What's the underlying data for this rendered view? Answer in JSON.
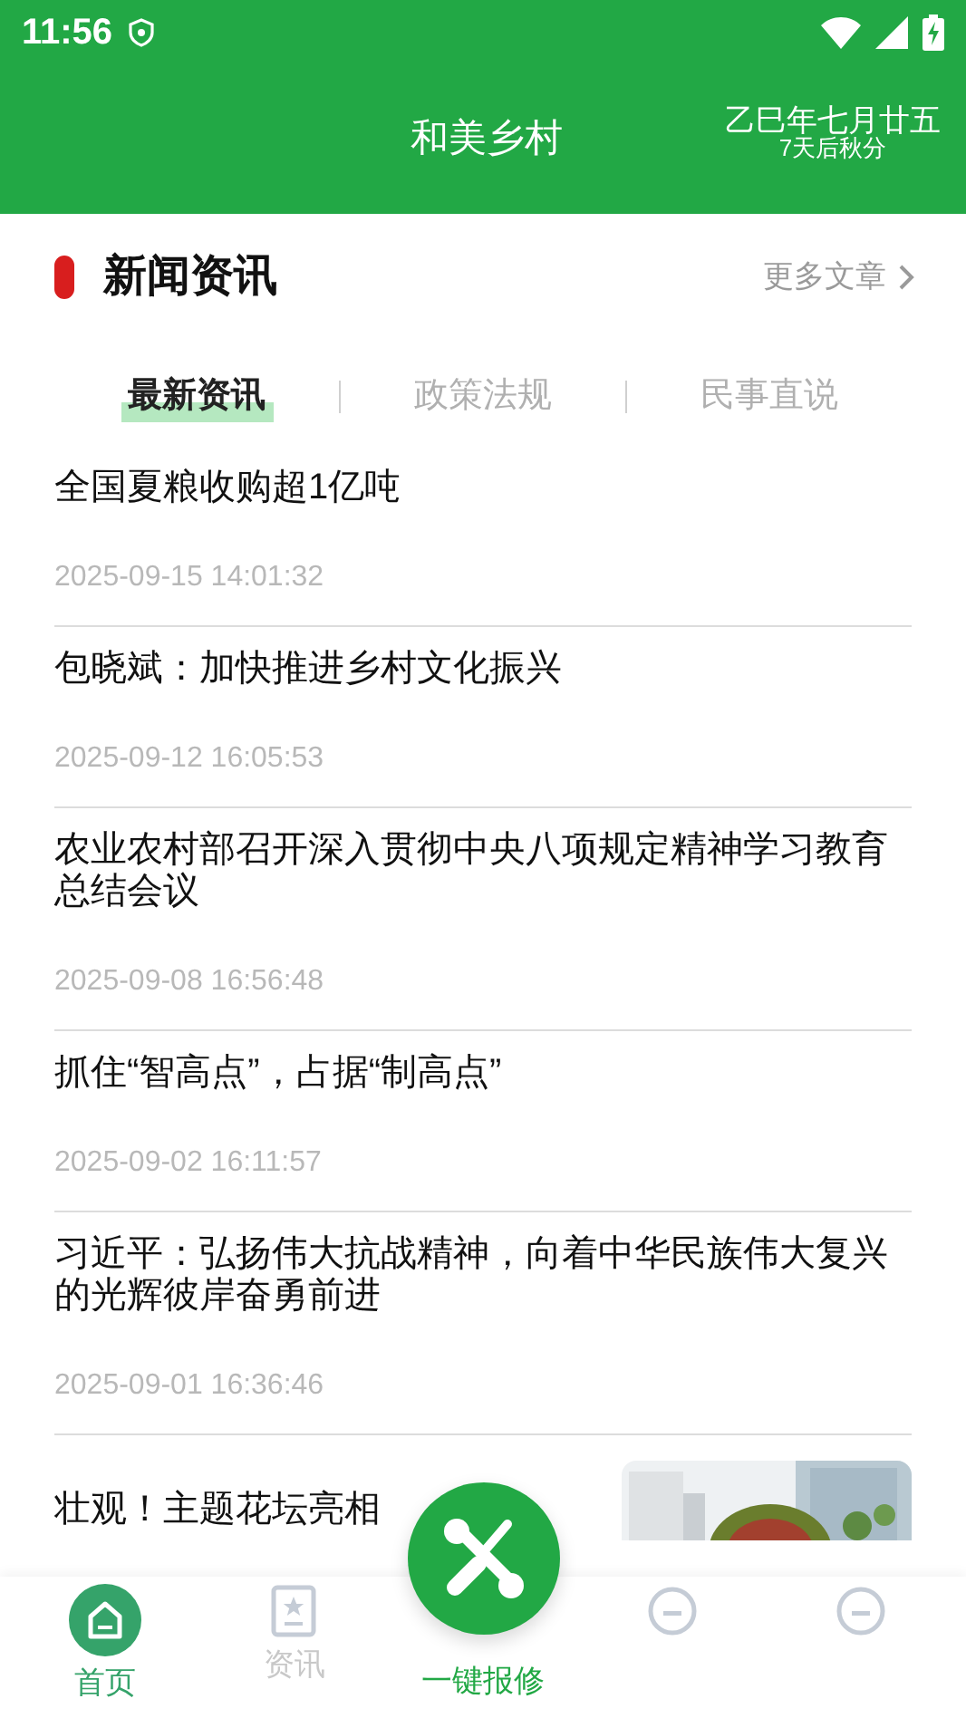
{
  "status_bar": {
    "time": "11:56"
  },
  "header": {
    "title": "和美乡村",
    "lunar_date": "乙巳年七月廿五",
    "solar_term": "7天后秋分"
  },
  "section": {
    "title": "新闻资讯",
    "more": "更多文章"
  },
  "tabs": [
    {
      "label": "最新资讯",
      "selected": true
    },
    {
      "label": "政策法规",
      "selected": false
    },
    {
      "label": "民事直说",
      "selected": false
    }
  ],
  "articles": [
    {
      "title": "全国夏粮收购超1亿吨",
      "date": "2025-09-15 14:01:32"
    },
    {
      "title": "包晓斌：加快推进乡村文化振兴",
      "date": "2025-09-12 16:05:53"
    },
    {
      "title": "农业农村部召开深入贯彻中央八项规定精神学习教育总结会议",
      "date": "2025-09-08 16:56:48"
    },
    {
      "title": "抓住“智高点”，占据“制高点”",
      "date": "2025-09-02 16:11:57"
    },
    {
      "title": "习近平：弘扬伟大抗战精神，向着中华民族伟大复兴的光辉彼岸奋勇前进",
      "date": "2025-09-01 16:36:46"
    },
    {
      "title": "壮观！主题花坛亮相"
    }
  ],
  "bottom_nav": [
    {
      "kind": "home",
      "label": "首页",
      "selected": true
    },
    {
      "kind": "news",
      "label": "资讯",
      "selected": false
    },
    {
      "kind": "repair",
      "label": "一键报修",
      "selected": false
    },
    {
      "kind": "message",
      "selected": false
    },
    {
      "kind": "profile",
      "selected": false
    }
  ]
}
